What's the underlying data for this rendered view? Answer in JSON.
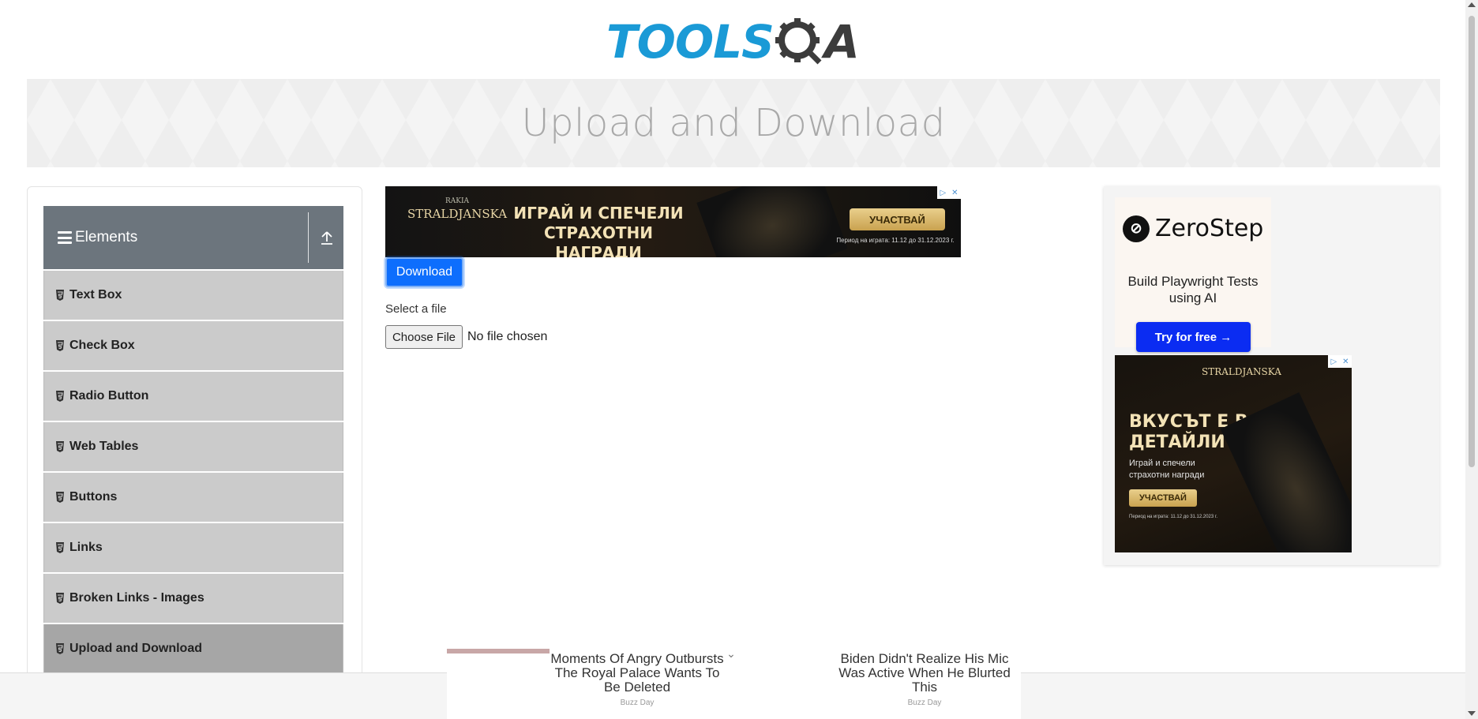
{
  "header": {
    "logo_text_tools": "TOOLS",
    "logo_text_qa": "A"
  },
  "banner": {
    "title": "Upload and Download"
  },
  "sidebar": {
    "group_title": "Elements",
    "items": [
      {
        "label": "Text Box"
      },
      {
        "label": "Check Box"
      },
      {
        "label": "Radio Button"
      },
      {
        "label": "Web Tables"
      },
      {
        "label": "Buttons"
      },
      {
        "label": "Links"
      },
      {
        "label": "Broken Links - Images"
      },
      {
        "label": "Upload and Download"
      }
    ],
    "active_item": "Upload and Download"
  },
  "main": {
    "download_label": "Download",
    "select_label": "Select a file",
    "choose_file_label": "Choose File",
    "file_status": "No file chosen"
  },
  "ads": {
    "top": {
      "brand": "STRALDJANSKA",
      "brand_small": "RAKIA",
      "headline": "ИГРАЙ И СПЕЧЕЛИ СТРАХОТНИ НАГРАДИ",
      "cta": "УЧАСТВАЙ",
      "period": "Период на играта: 11.12 до 31.12.2023 г."
    },
    "zerostep": {
      "name": "ZeroStep",
      "tagline": "Build Playwright Tests using AI",
      "cta": "Try for free →"
    },
    "side": {
      "brand": "STRALDJANSKA",
      "headline": "ВКУСЪТ Е В ДЕТАЙЛИТЕ",
      "sub": "Играй и спечели страхотни награди",
      "cta": "УЧАСТВАЙ",
      "period": "Период на играта: 11.12 до 31.12.2023 г."
    },
    "bottom": {
      "story1": "Moments Of Angry Outbursts The Royal Palace Wants To Be Deleted",
      "story1_source": "Buzz Day",
      "story2": "Biden Didn't Realize His Mic Was Active When He Blurted This",
      "story2_source": "Buzz Day"
    }
  },
  "colors": {
    "logo_blue": "#1a9ad6",
    "sidebar_header": "#6c757d",
    "menu_item": "#cbcbcb",
    "menu_active": "#a6a6a6",
    "download_button": "#0d6efd",
    "zerostep_button": "#0b2cf2"
  },
  "icons": {
    "menu": "hamburger-icon",
    "collapse": "upload-arrow-icon",
    "menu_item": "html5-icon"
  }
}
